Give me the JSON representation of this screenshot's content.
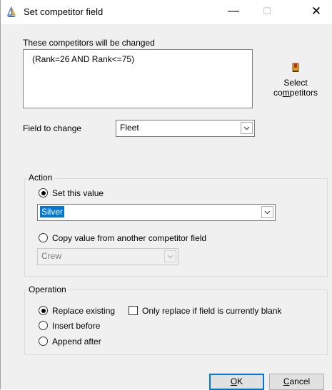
{
  "window": {
    "title": "Set competitor field",
    "minimize_glyph": "—",
    "maximize_glyph": "☐",
    "close_glyph": "✕",
    "icon": "sailboat-icon"
  },
  "competitors": {
    "label": "These competitors will be changed",
    "filter": "(Rank=26 AND Rank<=75)",
    "select_button": {
      "line1": "Select",
      "line2_pre": "co",
      "line2_u": "m",
      "line2_post": "petitors",
      "icon": "bookmark-flag-icon"
    }
  },
  "field": {
    "label": "Field to change",
    "value": "Fleet"
  },
  "action": {
    "legend": "Action",
    "set_value_label": "Set this value",
    "set_value": "Silver",
    "copy_label": "Copy value from another competitor field",
    "copy_field": "Crew",
    "selected": "set"
  },
  "operation": {
    "legend": "Operation",
    "replace_label": "Replace existing",
    "only_blank_label": "Only replace if field is currently blank",
    "only_blank_checked": false,
    "insert_label": "Insert before",
    "append_label": "Append after",
    "selected": "replace"
  },
  "buttons": {
    "ok_u": "O",
    "ok_rest": "K",
    "cancel_u": "C",
    "cancel_rest": "ancel"
  },
  "colors": {
    "accent": "#0078d7",
    "selection": "#0078d7"
  }
}
